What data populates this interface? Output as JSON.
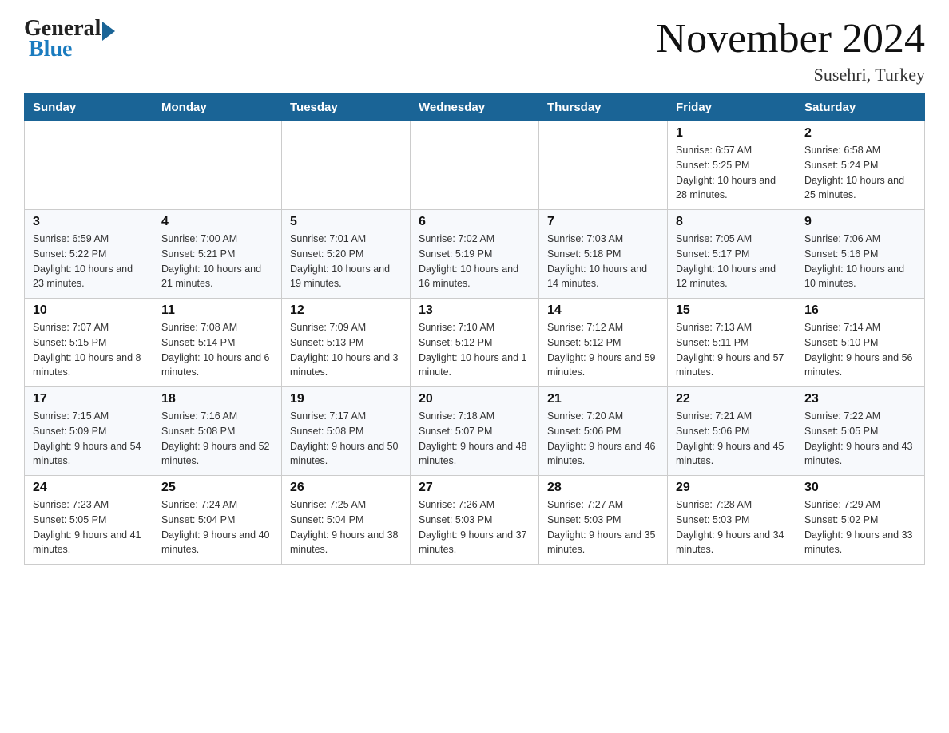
{
  "header": {
    "logo_general": "General",
    "logo_blue": "Blue",
    "month_title": "November 2024",
    "location": "Susehri, Turkey"
  },
  "days_of_week": [
    "Sunday",
    "Monday",
    "Tuesday",
    "Wednesday",
    "Thursday",
    "Friday",
    "Saturday"
  ],
  "weeks": [
    [
      {
        "day": "",
        "sunrise": "",
        "sunset": "",
        "daylight": ""
      },
      {
        "day": "",
        "sunrise": "",
        "sunset": "",
        "daylight": ""
      },
      {
        "day": "",
        "sunrise": "",
        "sunset": "",
        "daylight": ""
      },
      {
        "day": "",
        "sunrise": "",
        "sunset": "",
        "daylight": ""
      },
      {
        "day": "",
        "sunrise": "",
        "sunset": "",
        "daylight": ""
      },
      {
        "day": "1",
        "sunrise": "Sunrise: 6:57 AM",
        "sunset": "Sunset: 5:25 PM",
        "daylight": "Daylight: 10 hours and 28 minutes."
      },
      {
        "day": "2",
        "sunrise": "Sunrise: 6:58 AM",
        "sunset": "Sunset: 5:24 PM",
        "daylight": "Daylight: 10 hours and 25 minutes."
      }
    ],
    [
      {
        "day": "3",
        "sunrise": "Sunrise: 6:59 AM",
        "sunset": "Sunset: 5:22 PM",
        "daylight": "Daylight: 10 hours and 23 minutes."
      },
      {
        "day": "4",
        "sunrise": "Sunrise: 7:00 AM",
        "sunset": "Sunset: 5:21 PM",
        "daylight": "Daylight: 10 hours and 21 minutes."
      },
      {
        "day": "5",
        "sunrise": "Sunrise: 7:01 AM",
        "sunset": "Sunset: 5:20 PM",
        "daylight": "Daylight: 10 hours and 19 minutes."
      },
      {
        "day": "6",
        "sunrise": "Sunrise: 7:02 AM",
        "sunset": "Sunset: 5:19 PM",
        "daylight": "Daylight: 10 hours and 16 minutes."
      },
      {
        "day": "7",
        "sunrise": "Sunrise: 7:03 AM",
        "sunset": "Sunset: 5:18 PM",
        "daylight": "Daylight: 10 hours and 14 minutes."
      },
      {
        "day": "8",
        "sunrise": "Sunrise: 7:05 AM",
        "sunset": "Sunset: 5:17 PM",
        "daylight": "Daylight: 10 hours and 12 minutes."
      },
      {
        "day": "9",
        "sunrise": "Sunrise: 7:06 AM",
        "sunset": "Sunset: 5:16 PM",
        "daylight": "Daylight: 10 hours and 10 minutes."
      }
    ],
    [
      {
        "day": "10",
        "sunrise": "Sunrise: 7:07 AM",
        "sunset": "Sunset: 5:15 PM",
        "daylight": "Daylight: 10 hours and 8 minutes."
      },
      {
        "day": "11",
        "sunrise": "Sunrise: 7:08 AM",
        "sunset": "Sunset: 5:14 PM",
        "daylight": "Daylight: 10 hours and 6 minutes."
      },
      {
        "day": "12",
        "sunrise": "Sunrise: 7:09 AM",
        "sunset": "Sunset: 5:13 PM",
        "daylight": "Daylight: 10 hours and 3 minutes."
      },
      {
        "day": "13",
        "sunrise": "Sunrise: 7:10 AM",
        "sunset": "Sunset: 5:12 PM",
        "daylight": "Daylight: 10 hours and 1 minute."
      },
      {
        "day": "14",
        "sunrise": "Sunrise: 7:12 AM",
        "sunset": "Sunset: 5:12 PM",
        "daylight": "Daylight: 9 hours and 59 minutes."
      },
      {
        "day": "15",
        "sunrise": "Sunrise: 7:13 AM",
        "sunset": "Sunset: 5:11 PM",
        "daylight": "Daylight: 9 hours and 57 minutes."
      },
      {
        "day": "16",
        "sunrise": "Sunrise: 7:14 AM",
        "sunset": "Sunset: 5:10 PM",
        "daylight": "Daylight: 9 hours and 56 minutes."
      }
    ],
    [
      {
        "day": "17",
        "sunrise": "Sunrise: 7:15 AM",
        "sunset": "Sunset: 5:09 PM",
        "daylight": "Daylight: 9 hours and 54 minutes."
      },
      {
        "day": "18",
        "sunrise": "Sunrise: 7:16 AM",
        "sunset": "Sunset: 5:08 PM",
        "daylight": "Daylight: 9 hours and 52 minutes."
      },
      {
        "day": "19",
        "sunrise": "Sunrise: 7:17 AM",
        "sunset": "Sunset: 5:08 PM",
        "daylight": "Daylight: 9 hours and 50 minutes."
      },
      {
        "day": "20",
        "sunrise": "Sunrise: 7:18 AM",
        "sunset": "Sunset: 5:07 PM",
        "daylight": "Daylight: 9 hours and 48 minutes."
      },
      {
        "day": "21",
        "sunrise": "Sunrise: 7:20 AM",
        "sunset": "Sunset: 5:06 PM",
        "daylight": "Daylight: 9 hours and 46 minutes."
      },
      {
        "day": "22",
        "sunrise": "Sunrise: 7:21 AM",
        "sunset": "Sunset: 5:06 PM",
        "daylight": "Daylight: 9 hours and 45 minutes."
      },
      {
        "day": "23",
        "sunrise": "Sunrise: 7:22 AM",
        "sunset": "Sunset: 5:05 PM",
        "daylight": "Daylight: 9 hours and 43 minutes."
      }
    ],
    [
      {
        "day": "24",
        "sunrise": "Sunrise: 7:23 AM",
        "sunset": "Sunset: 5:05 PM",
        "daylight": "Daylight: 9 hours and 41 minutes."
      },
      {
        "day": "25",
        "sunrise": "Sunrise: 7:24 AM",
        "sunset": "Sunset: 5:04 PM",
        "daylight": "Daylight: 9 hours and 40 minutes."
      },
      {
        "day": "26",
        "sunrise": "Sunrise: 7:25 AM",
        "sunset": "Sunset: 5:04 PM",
        "daylight": "Daylight: 9 hours and 38 minutes."
      },
      {
        "day": "27",
        "sunrise": "Sunrise: 7:26 AM",
        "sunset": "Sunset: 5:03 PM",
        "daylight": "Daylight: 9 hours and 37 minutes."
      },
      {
        "day": "28",
        "sunrise": "Sunrise: 7:27 AM",
        "sunset": "Sunset: 5:03 PM",
        "daylight": "Daylight: 9 hours and 35 minutes."
      },
      {
        "day": "29",
        "sunrise": "Sunrise: 7:28 AM",
        "sunset": "Sunset: 5:03 PM",
        "daylight": "Daylight: 9 hours and 34 minutes."
      },
      {
        "day": "30",
        "sunrise": "Sunrise: 7:29 AM",
        "sunset": "Sunset: 5:02 PM",
        "daylight": "Daylight: 9 hours and 33 minutes."
      }
    ]
  ]
}
